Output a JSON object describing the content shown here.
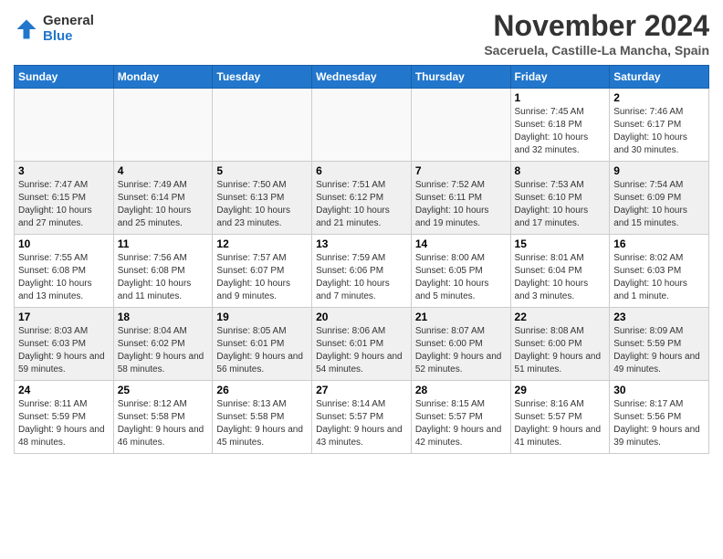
{
  "logo": {
    "general": "General",
    "blue": "Blue"
  },
  "header": {
    "month": "November 2024",
    "location": "Saceruela, Castille-La Mancha, Spain"
  },
  "days_of_week": [
    "Sunday",
    "Monday",
    "Tuesday",
    "Wednesday",
    "Thursday",
    "Friday",
    "Saturday"
  ],
  "weeks": [
    [
      {
        "day": "",
        "info": ""
      },
      {
        "day": "",
        "info": ""
      },
      {
        "day": "",
        "info": ""
      },
      {
        "day": "",
        "info": ""
      },
      {
        "day": "",
        "info": ""
      },
      {
        "day": "1",
        "info": "Sunrise: 7:45 AM\nSunset: 6:18 PM\nDaylight: 10 hours and 32 minutes."
      },
      {
        "day": "2",
        "info": "Sunrise: 7:46 AM\nSunset: 6:17 PM\nDaylight: 10 hours and 30 minutes."
      }
    ],
    [
      {
        "day": "3",
        "info": "Sunrise: 7:47 AM\nSunset: 6:15 PM\nDaylight: 10 hours and 27 minutes."
      },
      {
        "day": "4",
        "info": "Sunrise: 7:49 AM\nSunset: 6:14 PM\nDaylight: 10 hours and 25 minutes."
      },
      {
        "day": "5",
        "info": "Sunrise: 7:50 AM\nSunset: 6:13 PM\nDaylight: 10 hours and 23 minutes."
      },
      {
        "day": "6",
        "info": "Sunrise: 7:51 AM\nSunset: 6:12 PM\nDaylight: 10 hours and 21 minutes."
      },
      {
        "day": "7",
        "info": "Sunrise: 7:52 AM\nSunset: 6:11 PM\nDaylight: 10 hours and 19 minutes."
      },
      {
        "day": "8",
        "info": "Sunrise: 7:53 AM\nSunset: 6:10 PM\nDaylight: 10 hours and 17 minutes."
      },
      {
        "day": "9",
        "info": "Sunrise: 7:54 AM\nSunset: 6:09 PM\nDaylight: 10 hours and 15 minutes."
      }
    ],
    [
      {
        "day": "10",
        "info": "Sunrise: 7:55 AM\nSunset: 6:08 PM\nDaylight: 10 hours and 13 minutes."
      },
      {
        "day": "11",
        "info": "Sunrise: 7:56 AM\nSunset: 6:08 PM\nDaylight: 10 hours and 11 minutes."
      },
      {
        "day": "12",
        "info": "Sunrise: 7:57 AM\nSunset: 6:07 PM\nDaylight: 10 hours and 9 minutes."
      },
      {
        "day": "13",
        "info": "Sunrise: 7:59 AM\nSunset: 6:06 PM\nDaylight: 10 hours and 7 minutes."
      },
      {
        "day": "14",
        "info": "Sunrise: 8:00 AM\nSunset: 6:05 PM\nDaylight: 10 hours and 5 minutes."
      },
      {
        "day": "15",
        "info": "Sunrise: 8:01 AM\nSunset: 6:04 PM\nDaylight: 10 hours and 3 minutes."
      },
      {
        "day": "16",
        "info": "Sunrise: 8:02 AM\nSunset: 6:03 PM\nDaylight: 10 hours and 1 minute."
      }
    ],
    [
      {
        "day": "17",
        "info": "Sunrise: 8:03 AM\nSunset: 6:03 PM\nDaylight: 9 hours and 59 minutes."
      },
      {
        "day": "18",
        "info": "Sunrise: 8:04 AM\nSunset: 6:02 PM\nDaylight: 9 hours and 58 minutes."
      },
      {
        "day": "19",
        "info": "Sunrise: 8:05 AM\nSunset: 6:01 PM\nDaylight: 9 hours and 56 minutes."
      },
      {
        "day": "20",
        "info": "Sunrise: 8:06 AM\nSunset: 6:01 PM\nDaylight: 9 hours and 54 minutes."
      },
      {
        "day": "21",
        "info": "Sunrise: 8:07 AM\nSunset: 6:00 PM\nDaylight: 9 hours and 52 minutes."
      },
      {
        "day": "22",
        "info": "Sunrise: 8:08 AM\nSunset: 6:00 PM\nDaylight: 9 hours and 51 minutes."
      },
      {
        "day": "23",
        "info": "Sunrise: 8:09 AM\nSunset: 5:59 PM\nDaylight: 9 hours and 49 minutes."
      }
    ],
    [
      {
        "day": "24",
        "info": "Sunrise: 8:11 AM\nSunset: 5:59 PM\nDaylight: 9 hours and 48 minutes."
      },
      {
        "day": "25",
        "info": "Sunrise: 8:12 AM\nSunset: 5:58 PM\nDaylight: 9 hours and 46 minutes."
      },
      {
        "day": "26",
        "info": "Sunrise: 8:13 AM\nSunset: 5:58 PM\nDaylight: 9 hours and 45 minutes."
      },
      {
        "day": "27",
        "info": "Sunrise: 8:14 AM\nSunset: 5:57 PM\nDaylight: 9 hours and 43 minutes."
      },
      {
        "day": "28",
        "info": "Sunrise: 8:15 AM\nSunset: 5:57 PM\nDaylight: 9 hours and 42 minutes."
      },
      {
        "day": "29",
        "info": "Sunrise: 8:16 AM\nSunset: 5:57 PM\nDaylight: 9 hours and 41 minutes."
      },
      {
        "day": "30",
        "info": "Sunrise: 8:17 AM\nSunset: 5:56 PM\nDaylight: 9 hours and 39 minutes."
      }
    ]
  ]
}
